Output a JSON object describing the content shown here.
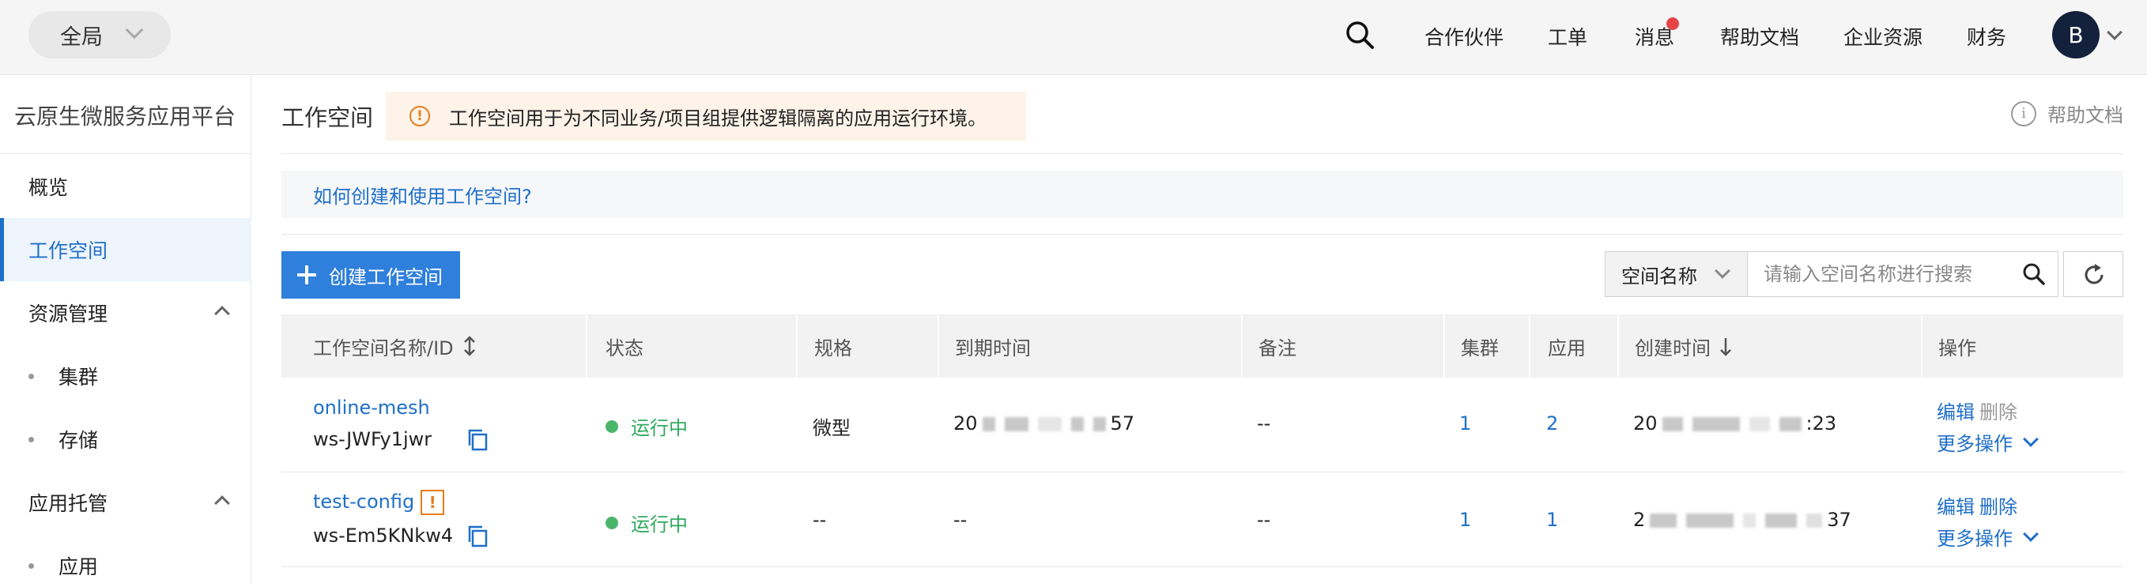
{
  "topbar": {
    "scope": "全局",
    "nav": [
      "合作伙伴",
      "工单",
      "消息",
      "帮助文档",
      "企业资源",
      "财务"
    ],
    "avatar_letter": "B"
  },
  "sidebar": {
    "title": "云原生微服务应用平台",
    "items": {
      "overview": "概览",
      "workspace": "工作空间",
      "resources": "资源管理",
      "cluster": "集群",
      "storage": "存储",
      "hosting": "应用托管",
      "app": "应用"
    }
  },
  "main": {
    "title": "工作空间",
    "notice": "工作空间用于为不同业务/项目组提供逻辑隔离的应用运行环境。",
    "help": "帮助文档",
    "howto": "如何创建和使用工作空间?",
    "create_label": "创建工作空间",
    "filter_select": "空间名称",
    "search_placeholder": "请输入空间名称进行搜索"
  },
  "table": {
    "headers": [
      "工作空间名称/ID",
      "状态",
      "规格",
      "到期时间",
      "备注",
      "集群",
      "应用",
      "创建时间",
      "操作"
    ],
    "rows": [
      {
        "name": "online-mesh",
        "id": "ws-JWFy1jwr",
        "status": "运行中",
        "spec": "微型",
        "expire_prefix": "20",
        "expire_suffix": "57",
        "note": "--",
        "clusters": "1",
        "apps": "2",
        "created_prefix": "20",
        "created_suffix": ":23",
        "edit": "编辑",
        "delete": "删除",
        "more": "更多操作"
      },
      {
        "name": "test-config",
        "id": "ws-Em5KNkw4",
        "warn": "!",
        "status": "运行中",
        "spec": "--",
        "expire": "--",
        "note": "--",
        "clusters": "1",
        "apps": "1",
        "created_prefix": "2",
        "created_suffix": "37",
        "edit": "编辑",
        "delete": "删除",
        "more": "更多操作"
      }
    ]
  },
  "colors": {
    "accent": "#1f6fc8",
    "primary_button": "#2f7fdc",
    "running": "#2eaa5d",
    "warning": "#e57e1b",
    "notification_dot": "#e54545"
  }
}
